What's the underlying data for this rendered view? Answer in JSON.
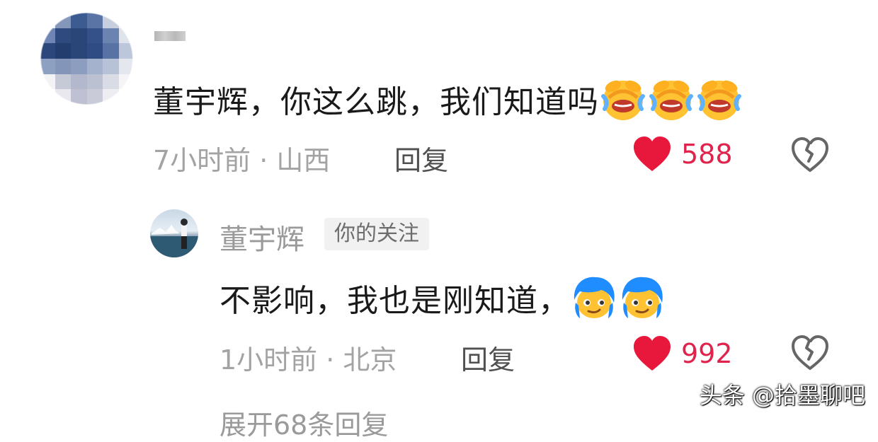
{
  "comment": {
    "text": "董宇辉，你这么跳，我们知道吗",
    "emojis": [
      "laugh-cry-emoji",
      "laugh-cry-emoji",
      "laugh-cry-emoji"
    ],
    "time_location": "7小时前 · 山西",
    "reply_label": "回复",
    "likes": "588"
  },
  "reply": {
    "username": "董宇辉",
    "tag": "你的关注",
    "text": "不影响，我也是刚知道，",
    "emojis": [
      "blue-hair-smirk-emoji",
      "blue-hair-smirk-emoji"
    ],
    "time_location": "1小时前 · 北京",
    "reply_label": "回复",
    "likes": "992"
  },
  "expand_label": "展开68条回复",
  "watermark": "头条 @拾墨聊吧",
  "colors": {
    "like_red": "#e0234d",
    "meta_gray": "#a3a3a3"
  }
}
